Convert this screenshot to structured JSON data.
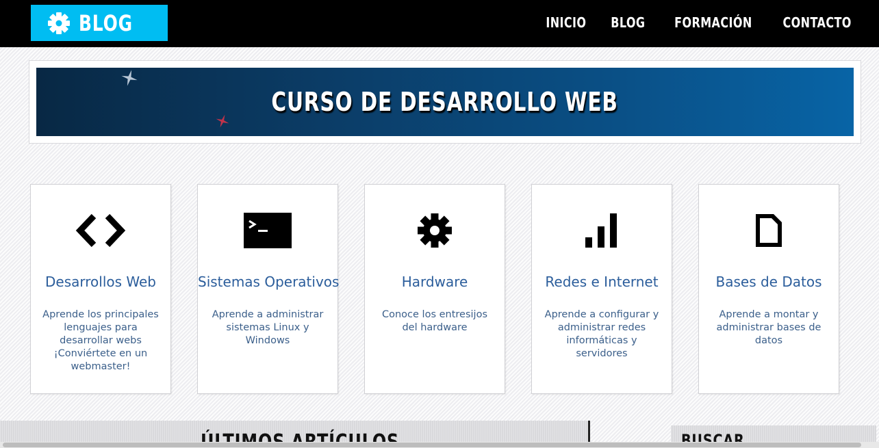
{
  "header": {
    "logo_text": "BLOG",
    "logo_icon": "gear-icon",
    "nav": [
      "INICIO",
      "BLOG",
      "FORMACIÓN",
      "CONTACTO"
    ]
  },
  "hero": {
    "title": "CURSO DE DESARROLLO WEB"
  },
  "cards": [
    {
      "title": "Desarrollos Web",
      "description": "Aprende los principales lenguajes para desarrollar webs ¡Conviértete en un webmaster!",
      "icon": "code-icon"
    },
    {
      "title": "Sistemas Operativos",
      "description": "Aprende a administrar sistemas Linux y Windows",
      "icon": "terminal-icon"
    },
    {
      "title": "Hardware",
      "description": "Conoce los entresijos del hardware",
      "icon": "gear-icon"
    },
    {
      "title": "Redes e Internet",
      "description": "Aprende a configurar y administrar redes informáticas y servidores",
      "icon": "signal-bars-icon"
    },
    {
      "title": "Bases de Datos",
      "description": "Aprende a montar y administrar bases de datos",
      "icon": "document-icon"
    }
  ],
  "sections": {
    "articles_title": "ÚLTIMOS ARTÍCULOS",
    "search_title": "BUSCAR"
  },
  "colors": {
    "header_bg": "#000000",
    "logo_bg": "#00bdf2",
    "card_title": "#2b5d9b",
    "card_desc": "#3b5f8a"
  }
}
